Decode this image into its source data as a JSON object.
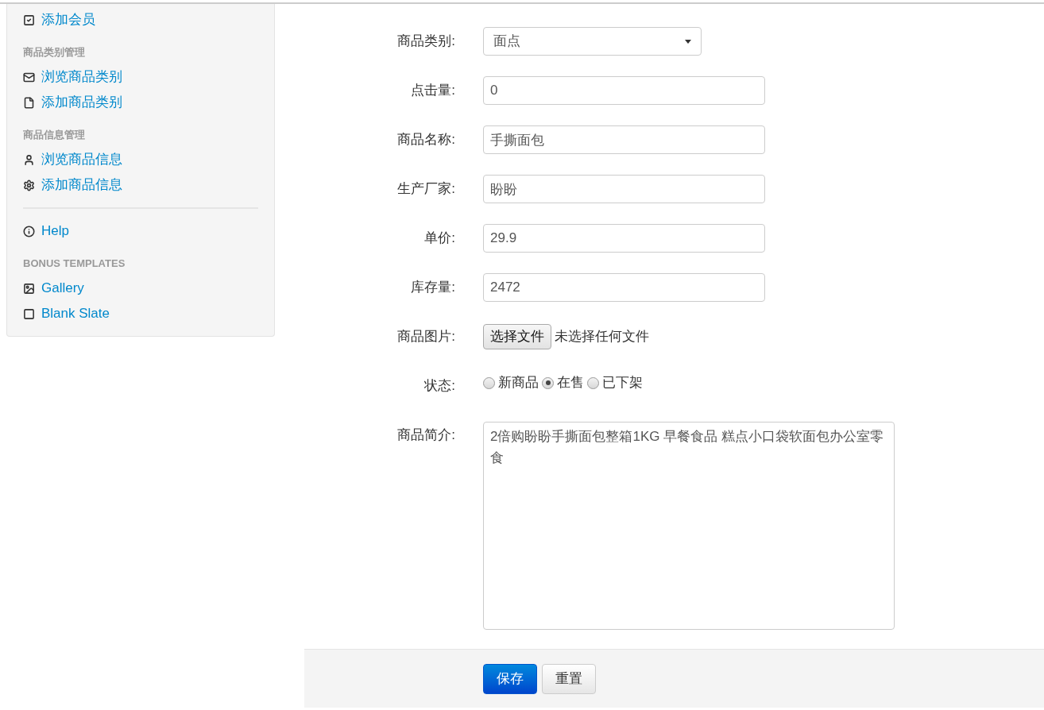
{
  "sidebar": {
    "items": [
      {
        "kind": "link",
        "label": "添加会员"
      },
      {
        "kind": "heading",
        "label": "商品类别管理"
      },
      {
        "kind": "link",
        "label": "浏览商品类别"
      },
      {
        "kind": "link",
        "label": "添加商品类别"
      },
      {
        "kind": "heading",
        "label": "商品信息管理"
      },
      {
        "kind": "link",
        "label": "浏览商品信息"
      },
      {
        "kind": "link",
        "label": "添加商品信息"
      },
      {
        "kind": "divider"
      },
      {
        "kind": "link",
        "label": "Help"
      },
      {
        "kind": "heading",
        "label": "BONUS TEMPLATES"
      },
      {
        "kind": "link",
        "label": "Gallery"
      },
      {
        "kind": "link",
        "label": "Blank Slate"
      }
    ]
  },
  "form": {
    "fields": [
      {
        "kind": "select",
        "label": "商品类别:",
        "value": "面点"
      },
      {
        "kind": "text",
        "label": "点击量:",
        "value": "0"
      },
      {
        "kind": "text",
        "label": "商品名称:",
        "value": "手撕面包"
      },
      {
        "kind": "text",
        "label": "生产厂家:",
        "value": "盼盼"
      },
      {
        "kind": "text",
        "label": "单价:",
        "value": "29.9"
      },
      {
        "kind": "text",
        "label": "库存量:",
        "value": "2472"
      },
      {
        "kind": "file",
        "label": "商品图片:",
        "button": "选择文件",
        "status": "未选择任何文件"
      },
      {
        "kind": "radio",
        "label": "状态:",
        "options": [
          {
            "label": "新商品",
            "selected": false
          },
          {
            "label": "在售",
            "selected": true
          },
          {
            "label": "已下架",
            "selected": false
          }
        ]
      },
      {
        "kind": "textarea",
        "label": "商品简介:",
        "value": "2倍购盼盼手撕面包整箱1KG 早餐食品 糕点小口袋软面包办公室零食"
      }
    ]
  },
  "actions": [
    {
      "kind": "primary",
      "label": "保存"
    },
    {
      "kind": "default",
      "label": "重置"
    }
  ]
}
